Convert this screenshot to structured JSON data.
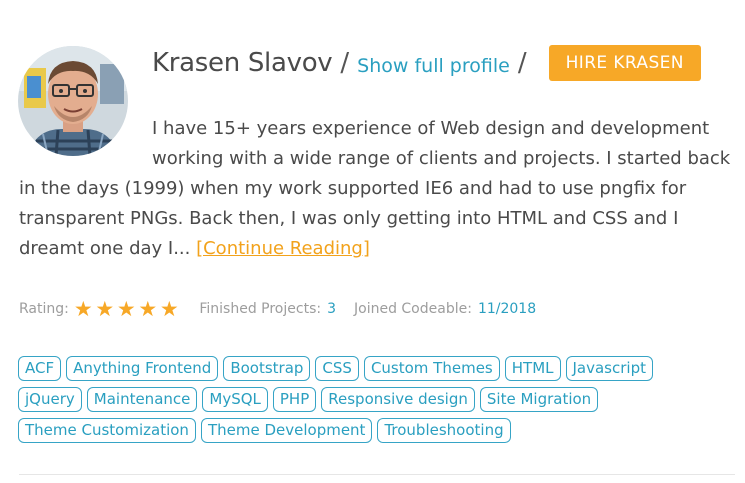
{
  "freelancer": {
    "name": "Krasen Slavov",
    "separator": "/",
    "profile_link": "Show full profile",
    "hire_label": "HIRE KRASEN"
  },
  "bio": {
    "text": "I have 15+ years experience of Web design and development working with a wide range of clients and projects. I started back in the days (1999) when my work supported IE6 and had to use pngfix for transparent PNGs. Back then, I was only getting into HTML and CSS and I dreamt one day I... ",
    "continue_label": "[Continue Reading]"
  },
  "stats": {
    "rating_label": "Rating:",
    "rating_value": 5,
    "rating_max": 5,
    "projects_label": "Finished Projects:",
    "projects_value": "3",
    "joined_label": "Joined Codeable:",
    "joined_value": "11/2018"
  },
  "tags": [
    "ACF",
    "Anything Frontend",
    "Bootstrap",
    "CSS",
    "Custom Themes",
    "HTML",
    "Javascript",
    "jQuery",
    "Maintenance",
    "MySQL",
    "PHP",
    "Responsive design",
    "Site Migration",
    "Theme Customization",
    "Theme Development",
    "Troubleshooting"
  ],
  "colors": {
    "accent_orange": "#f7a827",
    "link_blue": "#2a9fc0",
    "text": "#4a4a4a",
    "muted": "#9d9d9d"
  }
}
